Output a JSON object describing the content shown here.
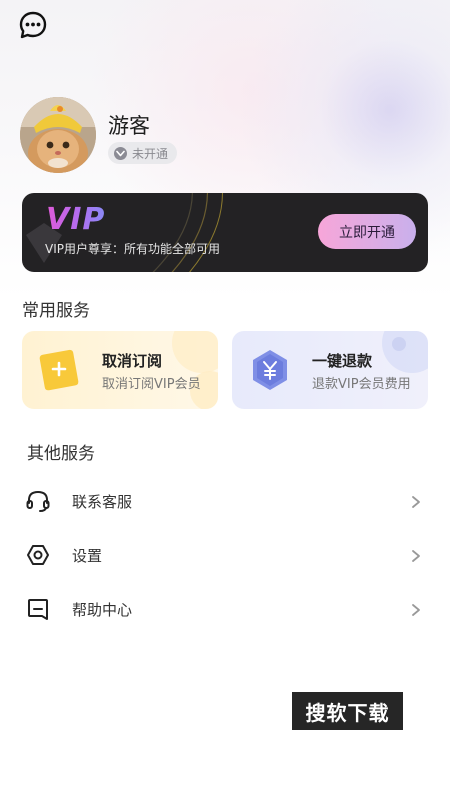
{
  "profile": {
    "username": "游客",
    "status": "未开通"
  },
  "vip_card": {
    "logo": "VIP",
    "description": "VIP用户尊享：所有功能全部可用",
    "button_label": "立即开通"
  },
  "common_services": {
    "title": "常用服务",
    "items": [
      {
        "name": "取消订阅",
        "description": "取消订阅VIP会员",
        "icon": "cancel-subscription-icon"
      },
      {
        "name": "一键退款",
        "description": "退款VIP会员费用",
        "icon": "yen-refund-icon"
      }
    ]
  },
  "other_services": {
    "title": "其他服务",
    "items": [
      {
        "label": "联系客服",
        "icon": "headset-icon"
      },
      {
        "label": "设置",
        "icon": "settings-hexagon-icon"
      },
      {
        "label": "帮助中心",
        "icon": "help-center-icon"
      }
    ]
  },
  "watermark": "搜软下载",
  "colors": {
    "vip_gradient_start": "#e05ad8",
    "vip_gradient_end": "#8a8af5",
    "vip_card_bg": "#232224",
    "open_button_start": "#f7a6d9",
    "open_button_end": "#c9b0ec",
    "card_yellow": "#fff2d2",
    "card_blue": "#e7eafb"
  }
}
